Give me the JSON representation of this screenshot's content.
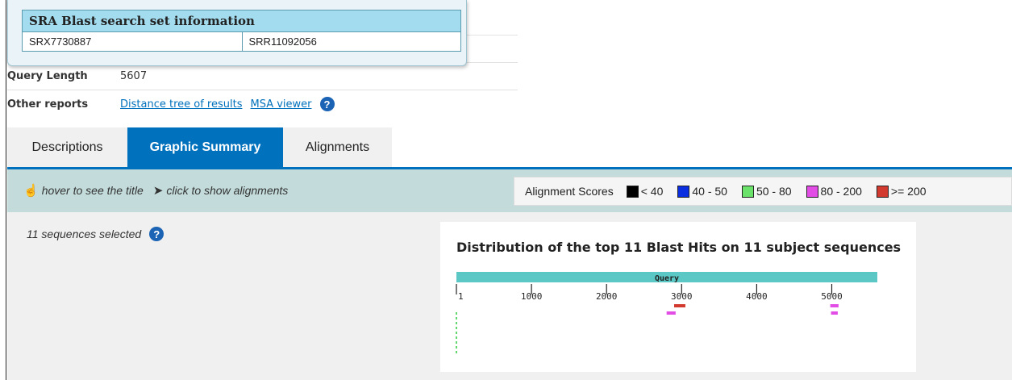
{
  "sra_popup": {
    "title": "SRA Blast search set information",
    "experiment": "SRX7730887",
    "run": "SRR11092056"
  },
  "info": {
    "query_length_label": "Query Length",
    "query_length_value": "5607",
    "other_reports_label": "Other reports",
    "links": [
      "Distance tree of results",
      "MSA viewer"
    ]
  },
  "tabs": [
    {
      "label": "Descriptions",
      "active": false
    },
    {
      "label": "Graphic Summary",
      "active": true
    },
    {
      "label": "Alignments",
      "active": false
    }
  ],
  "hints": {
    "hover": "hover to see the title",
    "click": "click to show alignments"
  },
  "alignment_scores": {
    "label": "Alignment Scores",
    "items": [
      {
        "label": "< 40",
        "color": "#000000"
      },
      {
        "label": "40 - 50",
        "color": "#0b2ee0"
      },
      {
        "label": "50 - 80",
        "color": "#6be36b"
      },
      {
        "label": "80 - 200",
        "color": "#e24de6"
      },
      {
        "label": ">= 200",
        "color": "#d23a2f"
      }
    ]
  },
  "selection": {
    "text": "11 sequences selected"
  },
  "graph": {
    "title": "Distribution of the top 11 Blast Hits on 11 subject sequences",
    "query_label": "Query",
    "query_length": 5607,
    "ticks": [
      1,
      1000,
      2000,
      3000,
      4000,
      5000
    ],
    "hits": [
      {
        "start": 2900,
        "end": 3050,
        "row": 0,
        "color": "#d23a2f"
      },
      {
        "start": 2800,
        "end": 2920,
        "row": 1,
        "color": "#e24de6"
      },
      {
        "start": 4980,
        "end": 5090,
        "row": 0,
        "color": "#e24de6"
      },
      {
        "start": 4990,
        "end": 5080,
        "row": 1,
        "color": "#e24de6"
      }
    ]
  }
}
